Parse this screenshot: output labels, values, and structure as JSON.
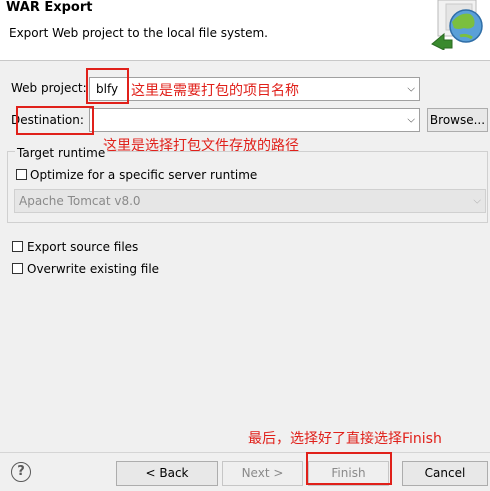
{
  "header": {
    "title": "WAR Export",
    "description": "Export Web project to the local file system."
  },
  "form": {
    "web_project_label": "Web project:",
    "web_project_value": "blfy",
    "destination_label": "Destination:",
    "destination_value": "",
    "browse_label": "Browse...",
    "target_runtime_label": "Target runtime",
    "optimize_label": "Optimize for a specific server runtime",
    "runtime_value": "Apache Tomcat v8.0",
    "export_source_label": "Export source files",
    "overwrite_label": "Overwrite existing file"
  },
  "annotations": {
    "project_note": "这里是需要打包的项目名称",
    "destination_note": "这里是选择打包文件存放的路径",
    "finish_note": "最后，选择好了直接选择Finish"
  },
  "footer": {
    "help_icon": "?",
    "back_label": "< Back",
    "next_label": "Next >",
    "finish_label": "Finish",
    "cancel_label": "Cancel"
  },
  "colors": {
    "annotation": "#e0201a",
    "header_bg": "#ffffff",
    "dialog_bg": "#f0f0f0"
  }
}
